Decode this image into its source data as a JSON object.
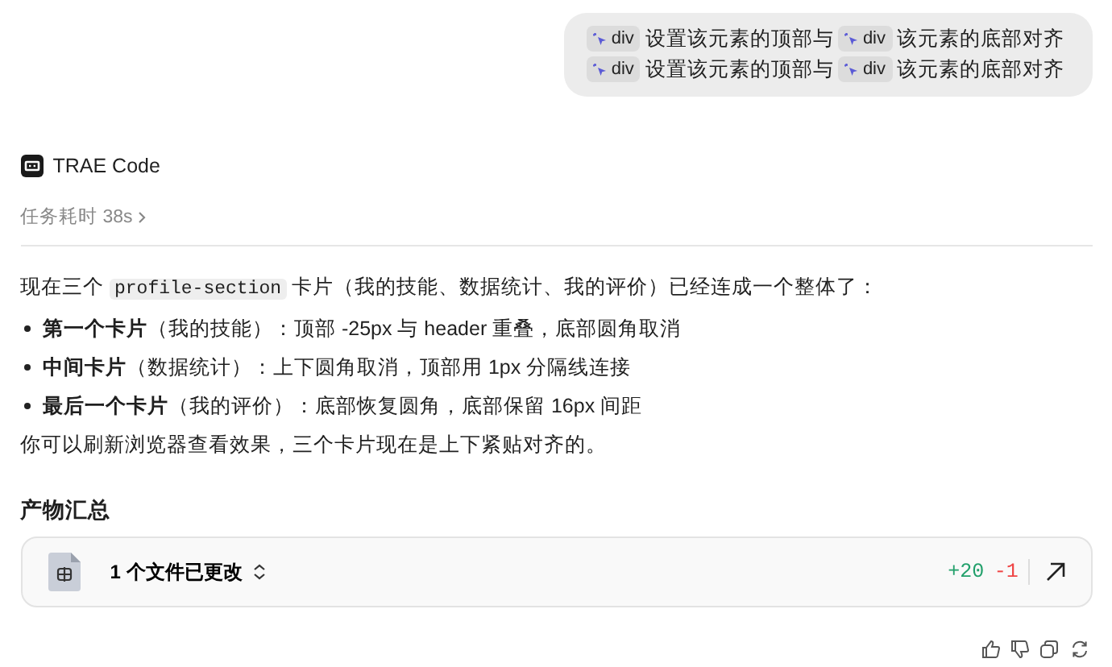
{
  "user_message": {
    "lines": [
      [
        {
          "kind": "chip",
          "text": "div"
        },
        {
          "kind": "text",
          "text": "设置该元素的顶部与"
        },
        {
          "kind": "chip",
          "text": "div"
        },
        {
          "kind": "text",
          "text": "该元素的底部对齐"
        }
      ],
      [
        {
          "kind": "chip",
          "text": "div"
        },
        {
          "kind": "text",
          "text": "设置该元素的顶部与"
        },
        {
          "kind": "chip",
          "text": "div"
        },
        {
          "kind": "text",
          "text": "该元素的底部对齐"
        }
      ]
    ]
  },
  "assistant": {
    "name": "TRAE Code",
    "duration": "任务耗时 38s",
    "intro": [
      {
        "kind": "text",
        "text": "现在三个 "
      },
      {
        "kind": "code",
        "text": "profile-section"
      },
      {
        "kind": "text",
        "text": " 卡片（我的技能、数据统计、我的评价）已经连成一个整体了："
      }
    ],
    "bullets": [
      "**第一个卡片**（我的技能）：顶部 -25px 与 header 重叠，底部圆角取消",
      "**中间卡片**（数据统计）：上下圆角取消，顶部用 1px 分隔线连接",
      "**最后一个卡片**（我的评价）：底部恢复圆角，底部保留 16px 间距"
    ],
    "closing": "你可以刷新浏览器查看效果，三个卡片现在是上下紧贴对齐的。"
  },
  "summary": {
    "title": "产物汇总",
    "file_card": {
      "label": "1 个文件已更改",
      "added": "+20",
      "removed": "-1"
    }
  }
}
